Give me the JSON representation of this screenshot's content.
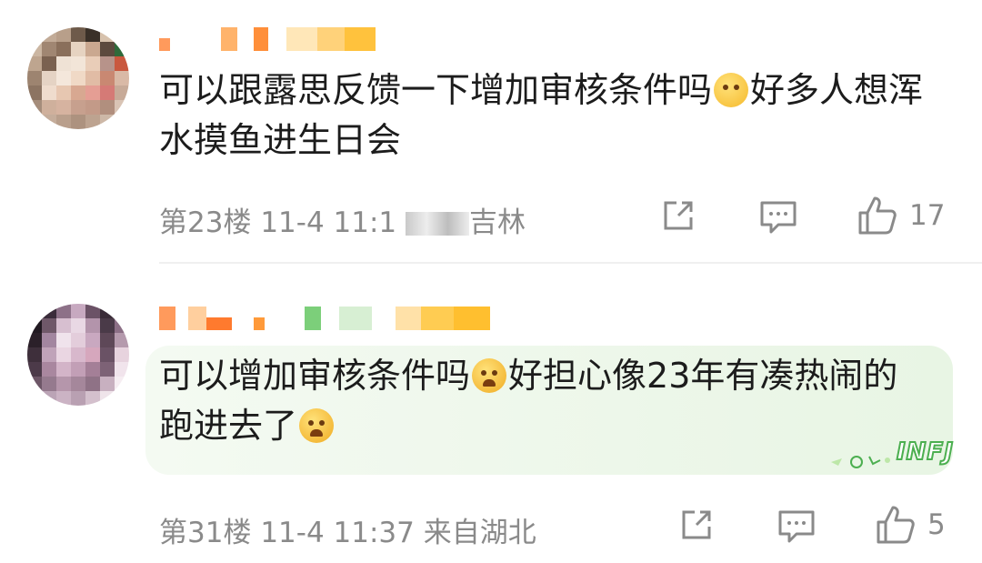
{
  "comments": [
    {
      "content_part1": "可以跟露思反馈一下增加审核条件吗",
      "emoji1": "pleading-face",
      "content_part2": "好多人想浑水摸鱼进生日会",
      "floor": "第23楼",
      "time": "11-4 11:1",
      "location": "吉林",
      "likes": "17"
    },
    {
      "content_part1": "可以增加审核条件吗",
      "emoji1": "crying-face",
      "content_part2": "好担心像23年有凑热闹的跑进去了",
      "emoji2": "crying-face",
      "floor": "第31楼",
      "time": "11-4 11:37",
      "location": "来自湖北",
      "likes": "5",
      "badge": "INFJ"
    }
  ],
  "colors": {
    "meta": "#8a8a8a",
    "text": "#1c1c1c",
    "bubble": "#e8f5e4",
    "badge_green": "#4caf50"
  }
}
